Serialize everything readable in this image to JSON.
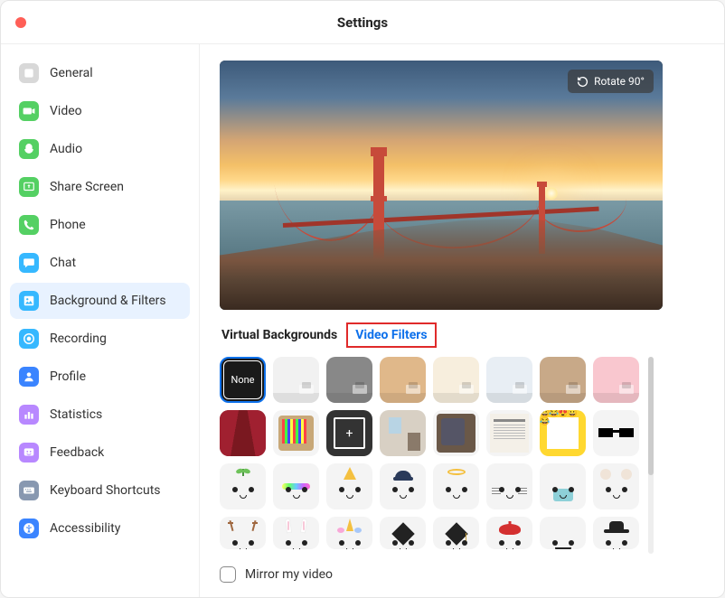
{
  "window": {
    "title": "Settings"
  },
  "sidebar": {
    "items": [
      {
        "id": "general",
        "label": "General",
        "color": "#d8d8d8",
        "active": false
      },
      {
        "id": "video",
        "label": "Video",
        "color": "#54d063",
        "active": false
      },
      {
        "id": "audio",
        "label": "Audio",
        "color": "#54d063",
        "active": false
      },
      {
        "id": "share",
        "label": "Share Screen",
        "color": "#54d063",
        "active": false
      },
      {
        "id": "phone",
        "label": "Phone",
        "color": "#54d063",
        "active": false
      },
      {
        "id": "chat",
        "label": "Chat",
        "color": "#36b8ff",
        "active": false
      },
      {
        "id": "background",
        "label": "Background & Filters",
        "color": "#36b8ff",
        "active": true
      },
      {
        "id": "recording",
        "label": "Recording",
        "color": "#36b8ff",
        "active": false
      },
      {
        "id": "profile",
        "label": "Profile",
        "color": "#3a84ff",
        "active": false
      },
      {
        "id": "statistics",
        "label": "Statistics",
        "color": "#b888ff",
        "active": false
      },
      {
        "id": "feedback",
        "label": "Feedback",
        "color": "#b888ff",
        "active": false
      },
      {
        "id": "shortcuts",
        "label": "Keyboard Shortcuts",
        "color": "#8898b0",
        "active": false
      },
      {
        "id": "accessibility",
        "label": "Accessibility",
        "color": "#3a84ff",
        "active": false
      }
    ]
  },
  "preview": {
    "rotate_label": "Rotate 90°"
  },
  "tabs": {
    "virtual_backgrounds": "Virtual Backgrounds",
    "video_filters": "Video Filters",
    "active": "video_filters"
  },
  "filters": {
    "none_label": "None",
    "rows": [
      [
        {
          "kind": "none"
        },
        {
          "kind": "room",
          "bg": "#f1f1f1"
        },
        {
          "kind": "room",
          "bg": "#888888"
        },
        {
          "kind": "room",
          "bg": "#e0b88a"
        },
        {
          "kind": "room",
          "bg": "#f7eedd"
        },
        {
          "kind": "room",
          "bg": "#e8eef4"
        },
        {
          "kind": "room",
          "bg": "#c8a988"
        },
        {
          "kind": "room",
          "bg": "#f9c7cf"
        }
      ],
      [
        {
          "kind": "theater"
        },
        {
          "kind": "retro-tv"
        },
        {
          "kind": "camera-frame"
        },
        {
          "kind": "window-room"
        },
        {
          "kind": "old-tv"
        },
        {
          "kind": "newspaper"
        },
        {
          "kind": "emoji-border"
        },
        {
          "kind": "pixel-glasses"
        }
      ],
      [
        {
          "kind": "face",
          "accessory": "sprout"
        },
        {
          "kind": "face",
          "accessory": "rainbow"
        },
        {
          "kind": "face",
          "accessory": "party-hat"
        },
        {
          "kind": "face",
          "accessory": "cap"
        },
        {
          "kind": "face",
          "accessory": "halo"
        },
        {
          "kind": "face",
          "accessory": "whiskers"
        },
        {
          "kind": "face",
          "accessory": "mask"
        },
        {
          "kind": "face",
          "accessory": "bear-ears"
        }
      ],
      [
        {
          "kind": "face",
          "accessory": "antlers"
        },
        {
          "kind": "face",
          "accessory": "bunny-ears"
        },
        {
          "kind": "face",
          "accessory": "unicorn"
        },
        {
          "kind": "face",
          "accessory": "grad-cap"
        },
        {
          "kind": "face",
          "accessory": "grad-cap-2"
        },
        {
          "kind": "face",
          "accessory": "beret"
        },
        {
          "kind": "face",
          "accessory": "mustache"
        },
        {
          "kind": "face",
          "accessory": "fedora"
        }
      ]
    ]
  },
  "footer": {
    "mirror_label": "Mirror my video",
    "mirror_checked": false
  }
}
